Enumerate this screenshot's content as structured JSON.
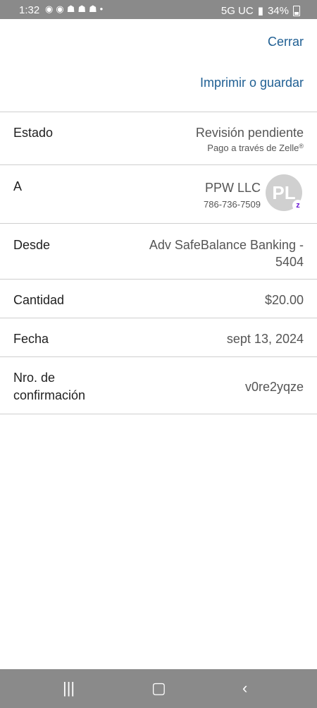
{
  "status_bar": {
    "time": "1:32",
    "network": "5G UC",
    "battery": "34%"
  },
  "actions": {
    "close_label": "Cerrar",
    "print_label": "Imprimir o guardar"
  },
  "details": {
    "status": {
      "label": "Estado",
      "value": "Revisión pendiente",
      "sub": "Pago a través de Zelle",
      "registered_mark": "®"
    },
    "to": {
      "label": "A",
      "name": "PPW LLC",
      "phone": "786-736-7509",
      "avatar_initials": "PL",
      "badge": "z"
    },
    "from": {
      "label": "Desde",
      "account_line1": "Adv SafeBalance Banking -",
      "account_line2": "5404"
    },
    "amount": {
      "label": "Cantidad",
      "value": "$20.00"
    },
    "date": {
      "label": "Fecha",
      "value": "sept 13, 2024"
    },
    "confirmation": {
      "label_line1": "Nro. de",
      "label_line2": "confirmación",
      "value": "v0re2yqze"
    }
  },
  "colors": {
    "link": "#1f5f93",
    "zelle": "#6d1ed4",
    "system_bars": "#8a8a8a"
  }
}
